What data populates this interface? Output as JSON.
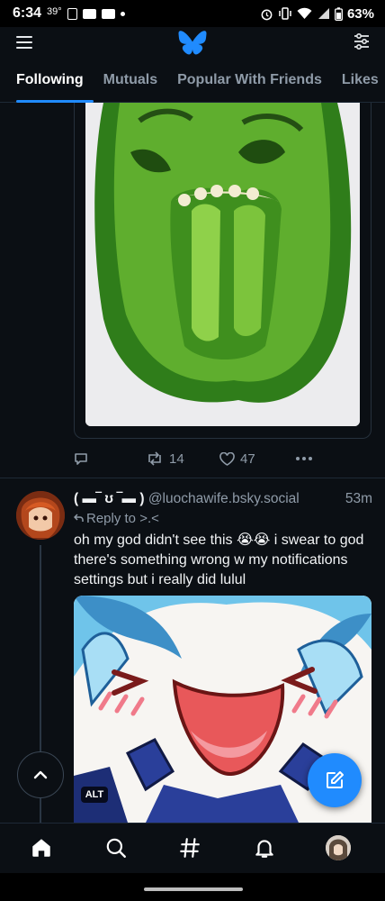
{
  "status_bar": {
    "time": "6:34",
    "temperature": "39°",
    "battery": "63%"
  },
  "header": {
    "logo": "butterfly-logo-icon",
    "tabs": [
      {
        "label": "Following",
        "active": true
      },
      {
        "label": "Mutuals",
        "active": false
      },
      {
        "label": "Popular With Friends",
        "active": false
      },
      {
        "label": "Likes",
        "active": false
      }
    ]
  },
  "post1": {
    "image": "green-bell-pepper-screaming-face",
    "reposts": "14",
    "likes": "47"
  },
  "post2": {
    "display_name": "( ▬‾ ʊ ‾▬ )",
    "handle": "@luochawife.bsky.social",
    "time": "53m",
    "reply_to": "Reply to >.<",
    "text": "oh my god didn't see this 😭😭 i swear to god there's something wrong w my notifications settings but i really did lulul",
    "image": "anime-character-laughing-closeup",
    "alt_badge": "ALT"
  },
  "bottom_nav": [
    "home-icon",
    "search-icon",
    "hashtag-icon",
    "notifications-bell-icon",
    "profile-avatar"
  ],
  "colors": {
    "accent": "#208bfe",
    "background": "#0b0f14",
    "muted_text": "#8f9ba8",
    "border": "#1e2936"
  }
}
